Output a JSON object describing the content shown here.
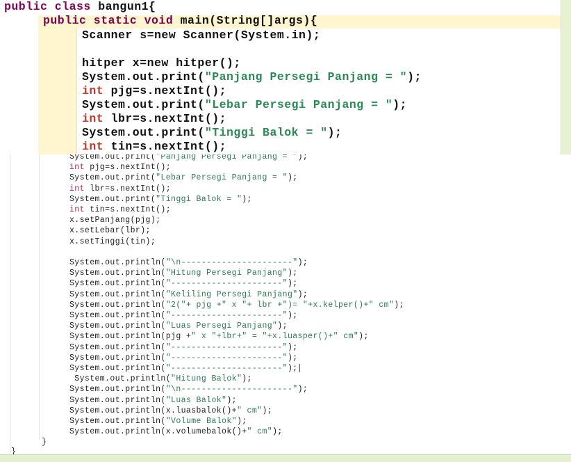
{
  "top": {
    "lines": [
      {
        "pre": "",
        "kw": "public class",
        "rest": " bangun1{"
      },
      {
        "pre": "    ",
        "kw": "public static void",
        "rest": " main(String[]args){"
      },
      {
        "pre": "        ",
        "kw": "",
        "rest": "Scanner s=new Scanner(System.in);"
      },
      {
        "pre": "",
        "kw": "",
        "rest": ""
      },
      {
        "pre": "        ",
        "kw": "",
        "rest": "hitper x=new hitper();"
      },
      {
        "pre": "        ",
        "kw": "",
        "rest": "System.out.print(\"Panjang Persegi Panjang = \");"
      },
      {
        "pre": "        ",
        "kw": "int",
        "rest": " pjg=s.nextInt();"
      },
      {
        "pre": "        ",
        "kw": "",
        "rest": "System.out.print(\"Lebar Persegi Panjang = \");"
      },
      {
        "pre": "        ",
        "kw": "int",
        "rest": " lbr=s.nextInt();"
      },
      {
        "pre": "        ",
        "kw": "",
        "rest": "System.out.print(\"Tinggi Balok = \");"
      },
      {
        "pre": "        ",
        "kw": "int",
        "rest": " tin=s.nextInt();"
      }
    ]
  },
  "bottom": {
    "lines": [
      "System.out.print(\"Panjang Persegi Panjang = \");",
      "int pjg=s.nextInt();",
      "System.out.print(\"Lebar Persegi Panjang = \");",
      "int lbr=s.nextInt();",
      "System.out.print(\"Tinggi Balok = \");",
      "int tin=s.nextInt();",
      "x.setPanjang(pjg);",
      "x.setLebar(lbr);",
      "x.setTinggi(tin);",
      "",
      "System.out.println(\"\\n----------------------\");",
      "System.out.println(\"Hitung Persegi Panjang\");",
      "System.out.println(\"----------------------\");",
      "System.out.println(\"Keliling Persegi Panjang\");",
      "System.out.println(\"2(\"+ pjg +\" x \"+ lbr +\")= \"+x.kelper()+\" cm\");",
      "System.out.println(\"----------------------\");",
      "System.out.println(\"Luas Persegi Panjang\");",
      "System.out.println(pjg +\" x \"+lbr+\" = \"+x.luasper()+\" cm\");",
      "System.out.println(\"----------------------\");",
      "System.out.println(\"----------------------\");",
      "System.out.println(\"----------------------\");",
      " System.out.println(\"Hitung Balok\");",
      "System.out.println(\"\\n----------------------\");",
      "System.out.println(\"Luas Balok\");",
      "System.out.println(x.luasbalok()+\" cm\");",
      "System.out.println(\"Volume Balok\");",
      "System.out.println(x.volumebalok()+\" cm\");",
      "}",
      "}"
    ]
  },
  "colors": {
    "keyword_top": "#7f0055",
    "string_top": "#2a8a55",
    "keyword_bottom": "#b5224b",
    "string_bottom": "#2a7a55",
    "highlight": "#fff6d0",
    "bottom_bar": "#e4f0d0",
    "caret": "#e02020"
  }
}
